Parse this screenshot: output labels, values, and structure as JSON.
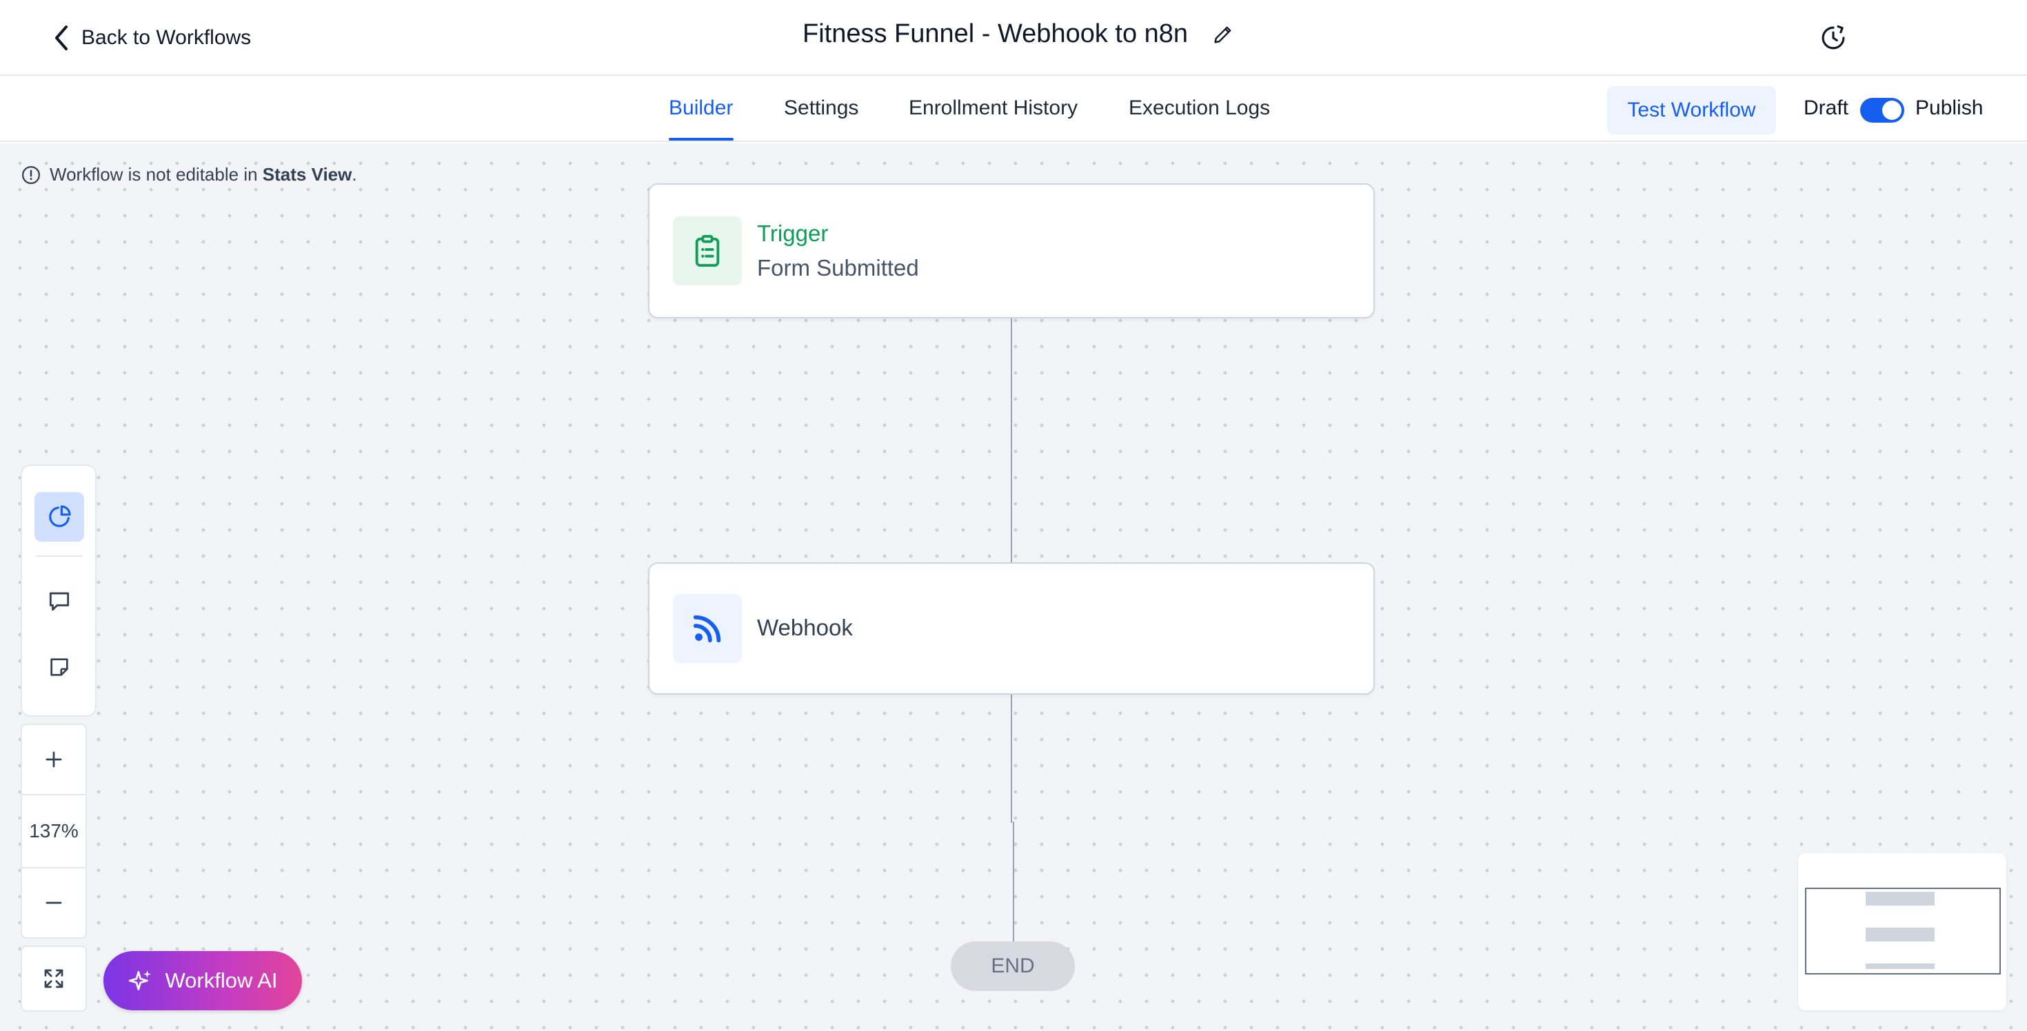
{
  "header": {
    "back_label": "Back to Workflows",
    "title": "Fitness Funnel - Webhook to n8n",
    "icons": {
      "back": "chevron-left-icon",
      "edit": "pencil-icon",
      "history": "history-clock-icon"
    }
  },
  "tabs": [
    {
      "label": "Builder",
      "active": true
    },
    {
      "label": "Settings",
      "active": false
    },
    {
      "label": "Enrollment History",
      "active": false
    },
    {
      "label": "Execution Logs",
      "active": false
    }
  ],
  "actions": {
    "test_label": "Test Workflow",
    "draft_label": "Draft",
    "publish_label": "Publish",
    "published": true
  },
  "canvas": {
    "notice_prefix": "Workflow is not editable in ",
    "notice_bold": "Stats View",
    "notice_suffix": ".",
    "nodes": {
      "trigger": {
        "title": "Trigger",
        "subtitle": "Form Submitted",
        "icon": "clipboard-list-icon"
      },
      "webhook": {
        "title": "Webhook",
        "icon": "rss-feed-icon"
      }
    },
    "end_label": "END"
  },
  "tools": {
    "items": [
      "stats-pie-icon",
      "comment-icon",
      "sticky-note-icon"
    ],
    "zoom_level": "137%"
  },
  "ai_button_label": "Workflow AI",
  "colors": {
    "accent": "#155eef",
    "trigger_green": "#0f9d58",
    "canvas_bg": "#f2f4f7",
    "ai_gradient_start": "#7a35e6",
    "ai_gradient_end": "#e2449a"
  }
}
